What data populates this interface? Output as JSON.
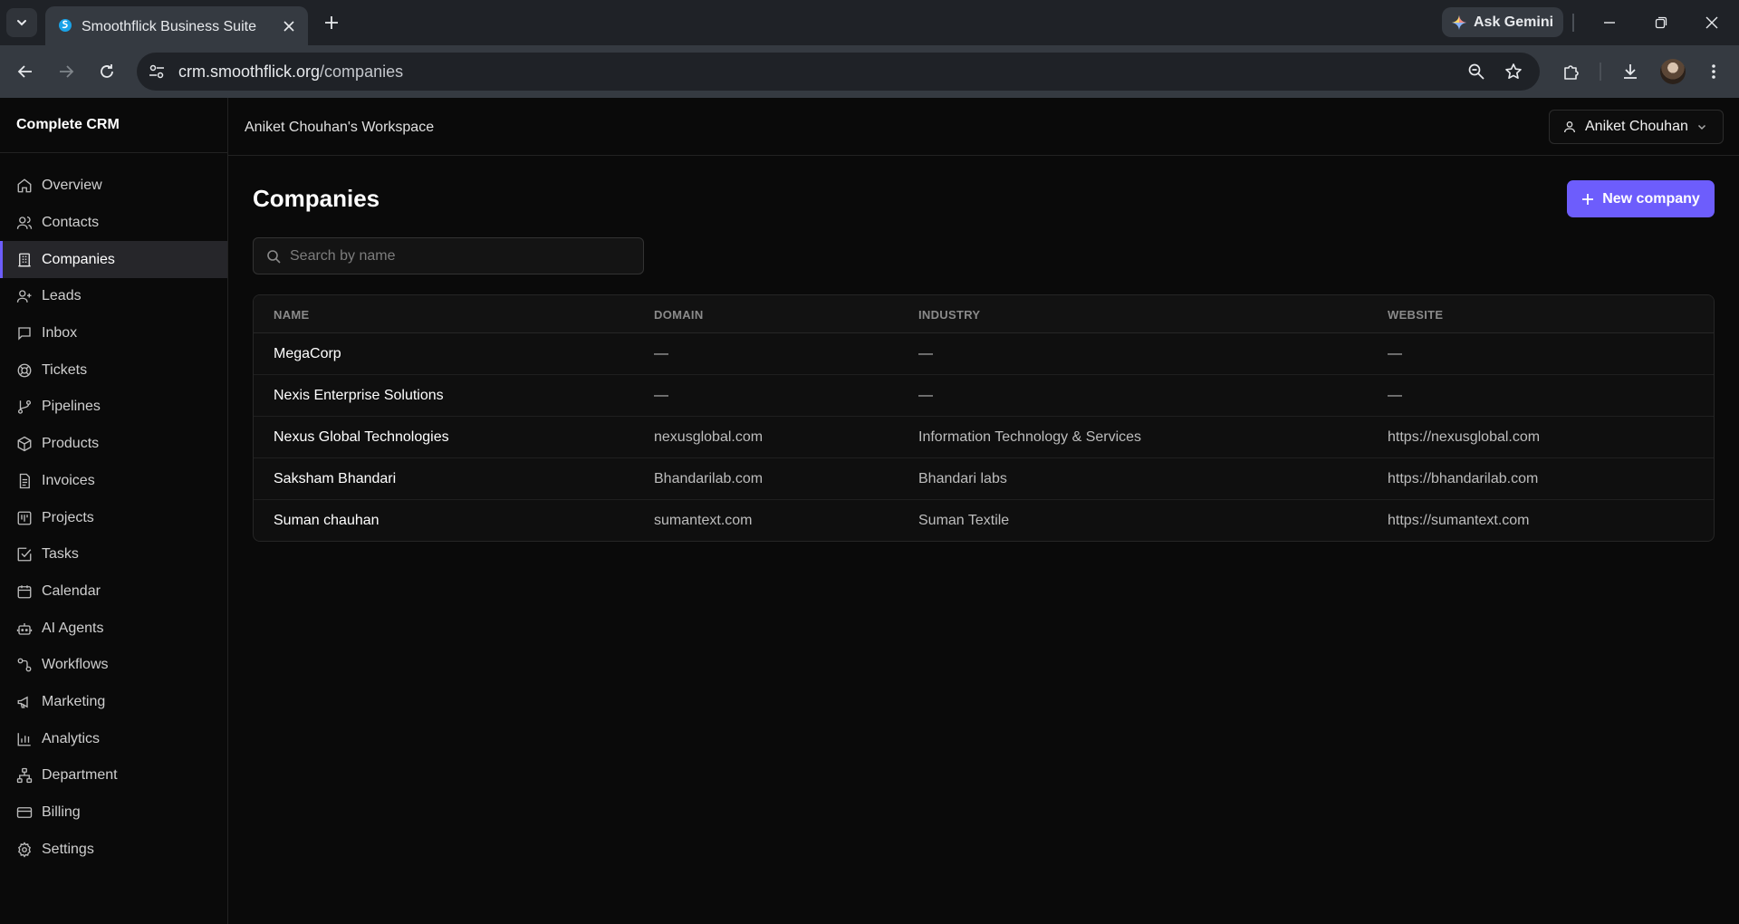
{
  "browser": {
    "tab_title": "Smoothflick Business Suite",
    "ask_gemini": "Ask Gemini",
    "url_host": "crm.smoothflick.org",
    "url_path": "/companies"
  },
  "sidebar": {
    "brand": "Complete CRM",
    "items": [
      {
        "label": "Overview",
        "icon": "home-icon"
      },
      {
        "label": "Contacts",
        "icon": "users-icon"
      },
      {
        "label": "Companies",
        "icon": "building-icon",
        "active": true
      },
      {
        "label": "Leads",
        "icon": "user-plus-icon"
      },
      {
        "label": "Inbox",
        "icon": "message-icon"
      },
      {
        "label": "Tickets",
        "icon": "lifebuoy-icon"
      },
      {
        "label": "Pipelines",
        "icon": "git-branch-icon"
      },
      {
        "label": "Products",
        "icon": "package-icon"
      },
      {
        "label": "Invoices",
        "icon": "file-text-icon"
      },
      {
        "label": "Projects",
        "icon": "kanban-icon"
      },
      {
        "label": "Tasks",
        "icon": "checkbox-icon"
      },
      {
        "label": "Calendar",
        "icon": "calendar-icon"
      },
      {
        "label": "AI Agents",
        "icon": "bot-icon"
      },
      {
        "label": "Workflows",
        "icon": "workflow-icon"
      },
      {
        "label": "Marketing",
        "icon": "megaphone-icon"
      },
      {
        "label": "Analytics",
        "icon": "bar-chart-icon"
      },
      {
        "label": "Department",
        "icon": "network-icon"
      },
      {
        "label": "Billing",
        "icon": "credit-card-icon"
      },
      {
        "label": "Settings",
        "icon": "gear-icon"
      }
    ]
  },
  "header": {
    "workspace": "Aniket Chouhan's Workspace",
    "user": "Aniket Chouhan"
  },
  "main": {
    "title": "Companies",
    "new_button": "New company",
    "search_placeholder": "Search by name",
    "columns": [
      "NAME",
      "DOMAIN",
      "INDUSTRY",
      "WEBSITE"
    ],
    "rows": [
      [
        "MegaCorp",
        "—",
        "—",
        "—"
      ],
      [
        "Nexis Enterprise Solutions",
        "—",
        "—",
        "—"
      ],
      [
        "Nexus Global Technologies",
        "nexusglobal.com",
        "Information Technology & Services",
        "https://nexusglobal.com"
      ],
      [
        "Saksham Bhandari",
        "Bhandarilab.com",
        "Bhandari labs",
        "https://bhandarilab.com"
      ],
      [
        "Suman chauhan",
        "sumantext.com",
        "Suman Textile",
        "https://sumantext.com"
      ]
    ]
  },
  "colors": {
    "accent": "#6d5dfc",
    "background": "#0a0a0a"
  }
}
